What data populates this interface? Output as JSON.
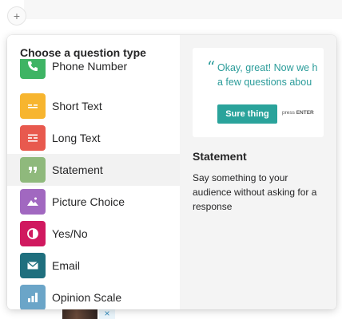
{
  "page": {
    "add_button_label": "+"
  },
  "picker": {
    "heading": "Choose a question type",
    "items": [
      {
        "label": "Phone Number",
        "icon": "phone-icon",
        "color": "#3eb464"
      },
      {
        "label": "Short Text",
        "icon": "short-text-icon",
        "color": "#f7b52f"
      },
      {
        "label": "Long Text",
        "icon": "long-text-icon",
        "color": "#e8594e"
      },
      {
        "label": "Statement",
        "icon": "quote-icon",
        "color": "#8fb97c",
        "active": true
      },
      {
        "label": "Picture Choice",
        "icon": "picture-icon",
        "color": "#a168c0"
      },
      {
        "label": "Yes/No",
        "icon": "yes-no-icon",
        "color": "#d0195f"
      },
      {
        "label": "Email",
        "icon": "email-icon",
        "color": "#1f6f7e"
      },
      {
        "label": "Opinion Scale",
        "icon": "bar-chart-icon",
        "color": "#6ba5c8"
      }
    ]
  },
  "preview": {
    "quote_mark": "“",
    "text_line1": "Okay, great! Now we h",
    "text_line2": "a few questions abou",
    "button_label": "Sure thing",
    "hint_prefix": "press",
    "hint_key": "ENTER",
    "accent_color": "#2aa39b"
  },
  "detail": {
    "title": "Statement",
    "description": "Say something to your audience without asking for a response"
  },
  "background": {
    "close_label": "×"
  }
}
